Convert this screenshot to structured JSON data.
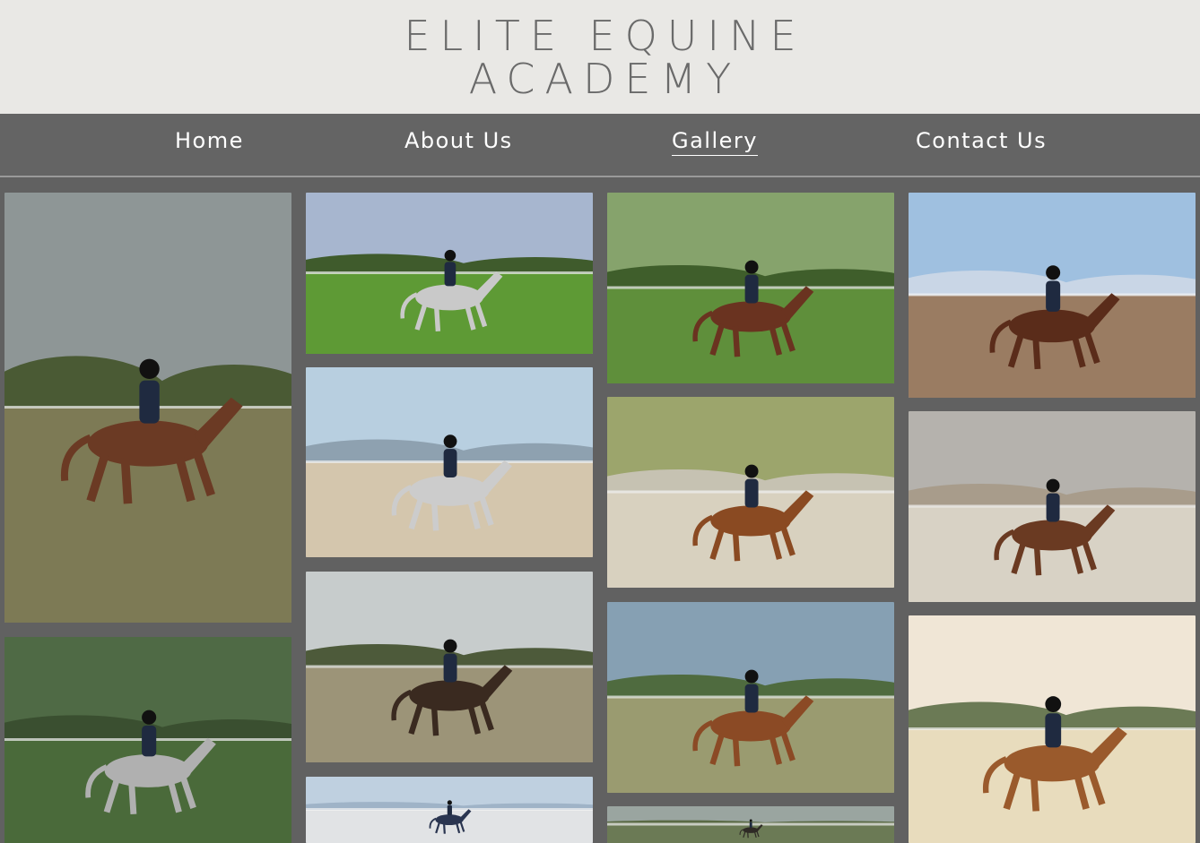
{
  "site": {
    "logo_line1": "ELITE EQUINE",
    "logo_line2": "ACADEMY"
  },
  "nav": {
    "items": [
      {
        "label": "Home",
        "active": false
      },
      {
        "label": "About Us",
        "active": false
      },
      {
        "label": "Gallery",
        "active": true
      },
      {
        "label": "Contact Us",
        "active": false
      }
    ]
  },
  "colors": {
    "header_bg": "#e9e8e5",
    "logo_text": "#6a6a6a",
    "nav_bg": "#646464",
    "page_bg": "#616161",
    "nav_text": "#ffffff"
  },
  "gallery": {
    "photos": [
      {
        "name": "gallery-photo-rider-walking-field",
        "sky": "#8e9696",
        "ground": "#7d7a55",
        "horse": "#6b3a24",
        "trees": "#4a5a34"
      },
      {
        "name": "gallery-photo-grey-horse-cantering",
        "sky": "#a7b6cf",
        "ground": "#5e9a35",
        "horse": "#c9c9c9",
        "trees": "#3f5b2c"
      },
      {
        "name": "gallery-photo-bay-jumping-arena",
        "sky": "#86a36c",
        "ground": "#5f8f3b",
        "horse": "#6a3320",
        "trees": "#3f5e2b"
      },
      {
        "name": "gallery-photo-bay-jumping-purple",
        "sky": "#9fc0e0",
        "ground": "#9a7c62",
        "horse": "#5a2c1a",
        "trees": "#c9d6e6"
      },
      {
        "name": "gallery-photo-rider-on-grey",
        "sky": "#4f6a45",
        "ground": "#4a6a3a",
        "horse": "#b0b0b0",
        "trees": "#3a4f30"
      },
      {
        "name": "gallery-photo-grey-horse-jumping",
        "sky": "#b8cfe0",
        "ground": "#d4c6ad",
        "horse": "#cccccc",
        "trees": "#8ea1b0"
      },
      {
        "name": "gallery-photo-dark-horse-jumping",
        "sky": "#c7cccc",
        "ground": "#9c9478",
        "horse": "#3a2a20",
        "trees": "#4d5a3a"
      },
      {
        "name": "gallery-photo-rider-helmet-blue",
        "sky": "#bfd0e0",
        "ground": "#e1e3e5",
        "horse": "#2a3550",
        "trees": "#9fb3c7"
      },
      {
        "name": "gallery-photo-chestnut-jumping",
        "sky": "#9ca56c",
        "ground": "#d8d1bf",
        "horse": "#8a4a22",
        "trees": "#c6c2b2"
      },
      {
        "name": "gallery-photo-bay-jumping-trees",
        "sky": "#86a0b3",
        "ground": "#9a9b70",
        "horse": "#8b4a25",
        "trees": "#4f6b3f"
      },
      {
        "name": "gallery-photo-rider-dark",
        "sky": "#9aa5a0",
        "ground": "#6b7a55",
        "horse": "#2e2a25",
        "trees": "#5a6a45"
      },
      {
        "name": "gallery-photo-bay-jumping-stone",
        "sky": "#b5b2ad",
        "ground": "#d8d2c5",
        "horse": "#6a3a22",
        "trees": "#a89c8b"
      },
      {
        "name": "gallery-photo-rider-white-jacket",
        "sky": "#f0e6d6",
        "ground": "#e8dcbd",
        "horse": "#9a5a2c",
        "trees": "#6b7a55"
      }
    ]
  }
}
